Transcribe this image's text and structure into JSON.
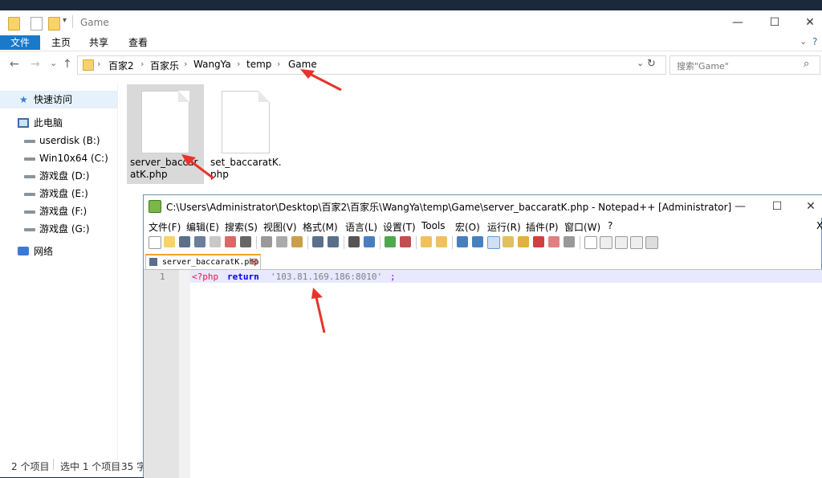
{
  "explorer": {
    "title": "Game",
    "ribbon_tabs": [
      "文件",
      "主页",
      "共享",
      "查看"
    ],
    "breadcrumbs": [
      "百家2",
      "百家乐",
      "WangYa",
      "temp",
      "Game"
    ],
    "search_placeholder": "搜索\"Game\"",
    "nav": {
      "quick_access": "快速访问",
      "this_pc": "此电脑",
      "drives": [
        "userdisk (B:)",
        "Win10x64 (C:)",
        "游戏盘 (D:)",
        "游戏盘 (E:)",
        "游戏盘 (F:)",
        "游戏盘 (G:)"
      ],
      "network": "网络"
    },
    "files": [
      {
        "name": "server_baccaratK.php",
        "selected": true
      },
      {
        "name": "set_baccaratK.php",
        "selected": false
      }
    ],
    "status": {
      "count": "2 个项目",
      "selection": "选中 1 个项目",
      "size": "35 字"
    },
    "icons": {
      "back": "←",
      "forward": "→",
      "recent": "⌄",
      "up": "↑",
      "refresh": "↻",
      "search": "⌕",
      "minimize": "—",
      "maximize": "☐",
      "close": "✕",
      "help": "?"
    }
  },
  "notepad": {
    "title": "C:\\Users\\Administrator\\Desktop\\百家2\\百家乐\\WangYa\\temp\\Game\\server_baccaratK.php - Notepad++ [Administrator]",
    "menus": [
      "文件(F)",
      "编辑(E)",
      "搜索(S)",
      "视图(V)",
      "格式(M)",
      "语言(L)",
      "设置(T)",
      "Tools",
      "宏(O)",
      "运行(R)",
      "插件(P)",
      "窗口(W)",
      "?"
    ],
    "menu_close": "X",
    "tab_label": "server_baccaratK.php",
    "line_number": "1",
    "code": {
      "open_tag": "<?php",
      "keyword": "return",
      "string": "'103.81.169.186:8010'",
      "terminator": ";"
    }
  },
  "colors": {
    "accent": "#1979ca",
    "annotation_arrow": "#e8332a"
  }
}
